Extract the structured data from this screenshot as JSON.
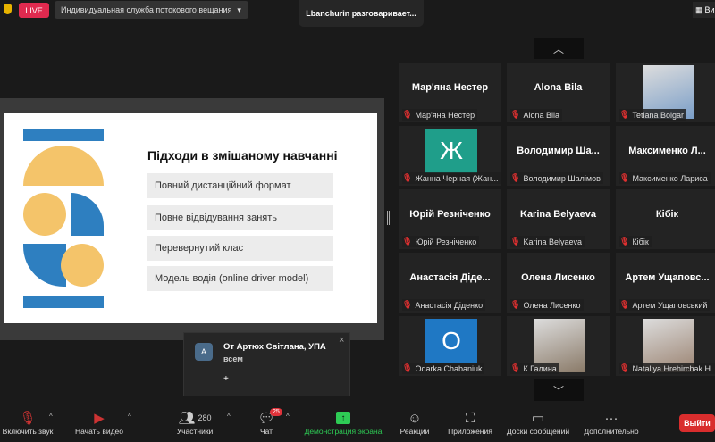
{
  "header": {
    "live": "LIVE",
    "stream": "Индивидуальная служба потокового вещания",
    "speaking": "Lbanchurin разговаривает...",
    "view": "Ви"
  },
  "slide": {
    "title": "Підходи в змішаному навчанні",
    "items": [
      "Повний дистанційний формат",
      "Повне відвідування занять",
      "Перевернутий клас",
      "Модель водія (online driver model)"
    ],
    "colors": {
      "blue": "#2e7fc0",
      "yellow": "#f4c46a"
    }
  },
  "participants": [
    {
      "big": "Мар'яна Нестер",
      "label": "Мар'яна Нестер"
    },
    {
      "big": "Alona Bila",
      "label": "Alona Bila"
    },
    {
      "photo": "#7a9ec8",
      "label": "Tetiana Bolgar"
    },
    {
      "avatar": "Ж",
      "avatar_color": "#1f9e8a",
      "label": "Жанна Черная (Жан..."
    },
    {
      "big": "Володимир  Ша...",
      "label": "Володимир Шалімов"
    },
    {
      "big": "Максименко  Л...",
      "label": "Максименко Лариса"
    },
    {
      "big": "Юрій Резніченко",
      "label": "Юрій Резніченко"
    },
    {
      "big": "Karina Belyaeva",
      "label": "Karina Belyaeva"
    },
    {
      "big": "Кібік",
      "label": "Кібік"
    },
    {
      "big": "Анастасія Діде...",
      "label": "Анастасія Діденко"
    },
    {
      "big": "Олена Лисенко",
      "label": "Олена Лисенко"
    },
    {
      "big": "Артем  Ущаповс...",
      "label": "Артем Ущаповський"
    },
    {
      "avatar": "O",
      "avatar_color": "#1f78c4",
      "label": "Odarka Chabaniuk"
    },
    {
      "photo": "#8a7a68",
      "label": "К.Галина"
    },
    {
      "photo": "#9a8270",
      "label": "Nataliya Hrehirchak H..."
    }
  ],
  "chat_popup": {
    "avatar": "A",
    "from": "От Артюх Світлана, УПА",
    "to": "всем",
    "plus": "+",
    "close": "×"
  },
  "toolbar": {
    "unmute": "Включить звук",
    "video": "Начать видео",
    "participants": "Участники",
    "participants_count": "280",
    "chat": "Чат",
    "chat_badge": "25",
    "share": "Демонстрация экрана",
    "reactions": "Реакции",
    "apps": "Приложения",
    "whiteboards": "Доски сообщений",
    "more": "Дополнительно",
    "leave": "Выйти"
  }
}
